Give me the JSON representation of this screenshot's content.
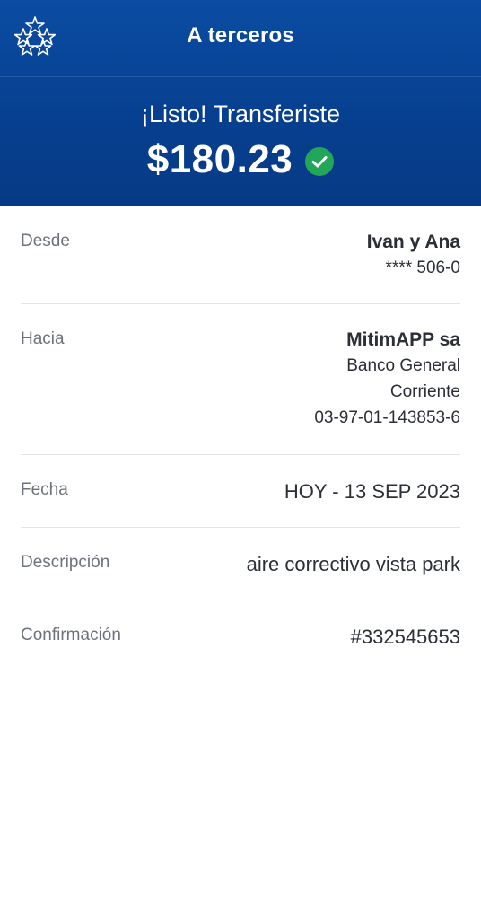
{
  "header": {
    "title": "A terceros",
    "logo_icon": "star-logo-icon",
    "background_color": "#0a4ca3"
  },
  "transfer": {
    "status_text": "¡Listo! Transferiste",
    "amount": "$180.23",
    "status_icon": "check-circle-icon",
    "success_color": "#21a65a"
  },
  "details": {
    "desde": {
      "label": "Desde",
      "name": "Ivan y Ana",
      "account": "**** 506-0"
    },
    "hacia": {
      "label": "Hacia",
      "name": "MitimAPP sa",
      "bank": "Banco General",
      "account_type": "Corriente",
      "account_number": "03-97-01-143853-6"
    },
    "fecha": {
      "label": "Fecha",
      "value": "HOY - 13 SEP 2023"
    },
    "descripcion": {
      "label": "Descripción",
      "value": "aire correctivo vista park"
    },
    "confirmacion": {
      "label": "Confirmación",
      "value": "#332545653"
    }
  }
}
